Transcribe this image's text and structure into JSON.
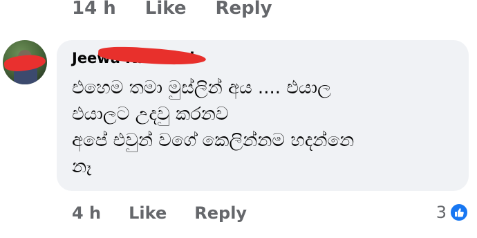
{
  "previous_comment": {
    "time": "14 h",
    "like_label": "Like",
    "reply_label": "Reply"
  },
  "comment": {
    "author": "Jeewa Kasthuri",
    "text": "එහෙම තමා මුස්ලින් අය .... එයාල\nඑයාලට උදවු කරනව\nඅපේ එවුන් වගේ කෙලින්නම හදන්නෙ\nනෑ",
    "time": "4 h",
    "like_label": "Like",
    "reply_label": "Reply",
    "reaction_count": "3",
    "reaction_icon": "like-thumb-icon",
    "reaction_color": "#1877f2"
  }
}
